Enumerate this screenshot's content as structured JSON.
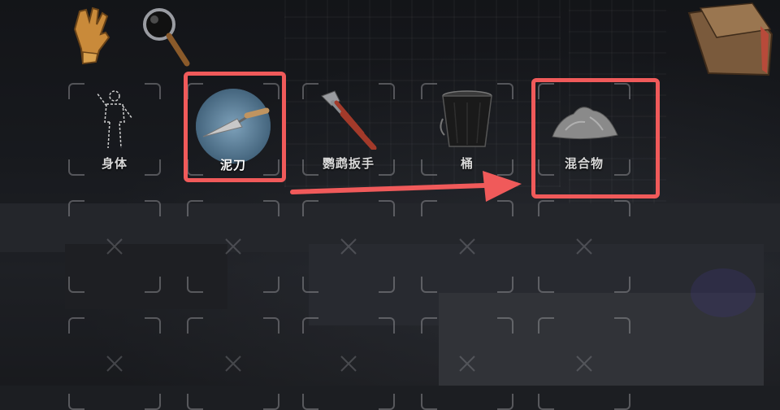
{
  "inventory": {
    "row1": [
      {
        "label": "身体",
        "icon": "body-outline-icon"
      },
      {
        "label": "泥刀",
        "icon": "trowel-icon",
        "selected": true
      },
      {
        "label": "鹦鹉扳手",
        "icon": "pipe-wrench-icon"
      },
      {
        "label": "桶",
        "icon": "bucket-icon"
      },
      {
        "label": "混合物",
        "icon": "mixture-pile-icon"
      }
    ],
    "empty_slot_icon": "x-mark-icon"
  },
  "top_bar": {
    "left_items": [
      "gloves-icon",
      "magnifying-glass-icon"
    ],
    "right_items": [
      "folder-icon"
    ]
  },
  "colors": {
    "highlight": "#f05a5a",
    "label": "#d8d8d8",
    "slot_corner": "#a0a0a5"
  },
  "annotation": {
    "type": "arrow",
    "from": "trowel-slot",
    "to": "mixture-slot"
  }
}
